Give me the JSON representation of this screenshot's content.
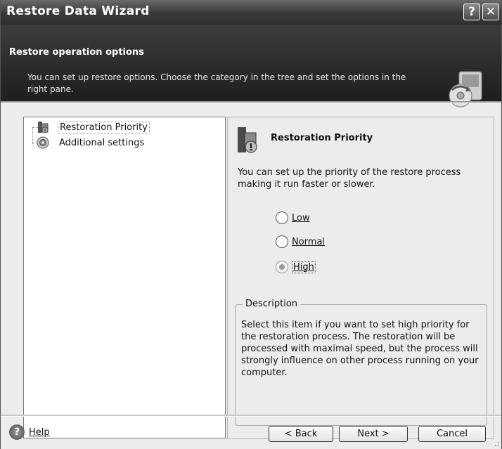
{
  "window": {
    "title": "Restore Data Wizard",
    "help_glyph": "?",
    "close_glyph": "✕"
  },
  "header": {
    "title": "Restore operation options",
    "subtitle": "You can set up restore options. Choose the category in the tree and set the options in the right pane.",
    "icon": "restore-wizard-icon"
  },
  "tree": {
    "items": [
      {
        "label": "Restoration Priority",
        "icon": "priority-icon",
        "selected": true
      },
      {
        "label": "Additional settings",
        "icon": "settings-disc-icon",
        "selected": false
      }
    ]
  },
  "pane": {
    "title": "Restoration Priority",
    "text": "You can set up the priority of the restore process making it run faster or slower.",
    "options": [
      {
        "label": "Low",
        "checked": false
      },
      {
        "label": "Normal",
        "checked": false
      },
      {
        "label": "High",
        "checked": true
      }
    ],
    "description_legend": "Description",
    "description_text": "Select this item if you want to set high priority for the restoration process. The restoration will be processed with maximal speed, but the process will strongly influence on other process running on your computer."
  },
  "footer": {
    "help_label": "Help",
    "back_label": "< Back",
    "next_label": "Next >",
    "cancel_label": "Cancel"
  }
}
